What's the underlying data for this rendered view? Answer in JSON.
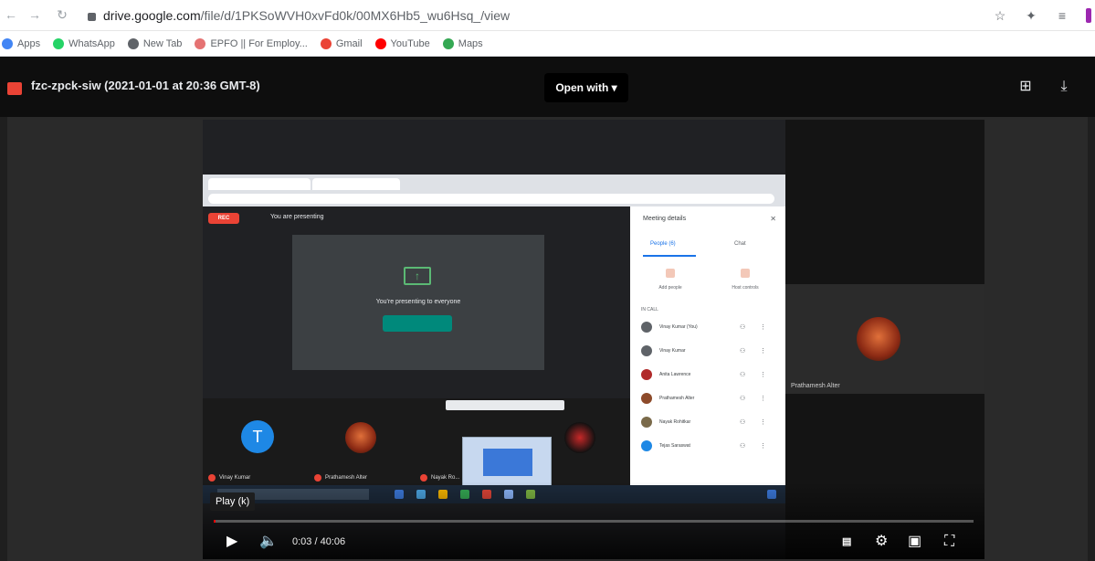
{
  "browser": {
    "url_host": "drive.google.com",
    "url_path": "/file/d/1PKSoWVH0xvFd0k/00MX6Hb5_wu6Hsq_/view",
    "bookmarks": [
      {
        "label": "Apps",
        "color": "#4285f4"
      },
      {
        "label": "WhatsApp",
        "color": "#25d366"
      },
      {
        "label": "New Tab",
        "color": "#5f6368"
      },
      {
        "label": "EPFO || For Employ...",
        "color": "#e57373"
      },
      {
        "label": "Gmail",
        "color": "#ea4335"
      },
      {
        "label": "YouTube",
        "color": "#ff0000"
      },
      {
        "label": "Maps",
        "color": "#34a853"
      }
    ]
  },
  "drive": {
    "file_title": "fzc-zpck-siw (2021-01-01 at 20:36 GMT-8)",
    "open_with_label": "Open with",
    "accent": "#ea4335"
  },
  "meet": {
    "presenting_label": "You are presenting",
    "rec_label": "REC",
    "present_message": "You're presenting to everyone",
    "details_title": "Meeting details",
    "tab_people": "People (6)",
    "tab_chat": "Chat",
    "actions": [
      "Add people",
      "Host controls"
    ],
    "in_call_label": "IN CALL",
    "participants": [
      {
        "name": "Vinay Kumar (You)",
        "color": "#5f6368"
      },
      {
        "name": "Vinay Kumar",
        "color": "#5f6368"
      },
      {
        "name": "Anita Lawrence",
        "color": "#b02a2a"
      },
      {
        "name": "Prathamesh Alter",
        "color": "#8d4a2a"
      },
      {
        "name": "Nayak Rohitkar",
        "color": "#7a6a4a"
      },
      {
        "name": "Tejas Saraswat",
        "color": "#1e88e5"
      }
    ],
    "strip_names": [
      "Vinay Kumar",
      "Prathamesh Alter",
      "Nayak Ro..."
    ],
    "side_tile_name": "Prathamesh Alter"
  },
  "player": {
    "tooltip": "Play (k)",
    "time": "0:03 / 40:06",
    "progress": 0.0012,
    "icons": [
      "play-icon",
      "volume-icon",
      "subtitles-icon",
      "settings-icon",
      "miniplayer-icon",
      "fullscreen-icon"
    ]
  }
}
